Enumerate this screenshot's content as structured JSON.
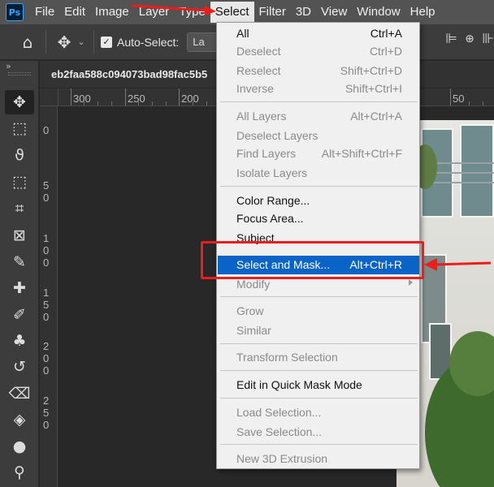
{
  "app": {
    "logo": "Ps"
  },
  "menubar": {
    "items": [
      "File",
      "Edit",
      "Image",
      "Layer",
      "Type",
      "Select",
      "Filter",
      "3D",
      "View",
      "Window",
      "Help"
    ],
    "active": "Select"
  },
  "options_bar": {
    "home_icon": "home-icon",
    "move_icon": "move-tool-icon",
    "auto_select_label": "Auto-Select:",
    "auto_select_checked": true,
    "layer_dropdown_value": "La"
  },
  "document": {
    "tab_title": "eb2faa588c094073bad98fac5b5"
  },
  "rulers": {
    "horizontal": [
      "300",
      "250",
      "200",
      "50"
    ],
    "vertical": [
      [
        "0"
      ],
      [
        "5",
        "0"
      ],
      [
        "1",
        "0",
        "0"
      ],
      [
        "1",
        "5",
        "0"
      ],
      [
        "2",
        "0",
        "0"
      ],
      [
        "2",
        "5",
        "0"
      ]
    ]
  },
  "toolbar": {
    "tools": [
      "move-tool-icon",
      "marquee-tool-icon",
      "lasso-tool-icon",
      "object-select-tool-icon",
      "crop-tool-icon",
      "frame-tool-icon",
      "eyedropper-tool-icon",
      "healing-brush-tool-icon",
      "brush-tool-icon",
      "clone-stamp-tool-icon",
      "history-brush-tool-icon",
      "eraser-tool-icon",
      "paint-bucket-tool-icon",
      "blur-tool-icon",
      "dodge-tool-icon"
    ]
  },
  "select_menu": {
    "items": [
      {
        "label": "All",
        "shortcut": "Ctrl+A",
        "enabled": true
      },
      {
        "label": "Deselect",
        "shortcut": "Ctrl+D",
        "enabled": false
      },
      {
        "label": "Reselect",
        "shortcut": "Shift+Ctrl+D",
        "enabled": false
      },
      {
        "label": "Inverse",
        "shortcut": "Shift+Ctrl+I",
        "enabled": false
      },
      {
        "label": "All Layers",
        "shortcut": "Alt+Ctrl+A",
        "enabled": false
      },
      {
        "label": "Deselect Layers",
        "shortcut": "",
        "enabled": false
      },
      {
        "label": "Find Layers",
        "shortcut": "Alt+Shift+Ctrl+F",
        "enabled": false
      },
      {
        "label": "Isolate Layers",
        "shortcut": "",
        "enabled": false
      },
      {
        "label": "Color Range...",
        "shortcut": "",
        "enabled": true
      },
      {
        "label": "Focus Area...",
        "shortcut": "",
        "enabled": true
      },
      {
        "label": "Subject",
        "shortcut": "",
        "enabled": true
      },
      {
        "label": "Select and Mask...",
        "shortcut": "Alt+Ctrl+R",
        "enabled": true,
        "highlighted": true
      },
      {
        "label": "Modify",
        "shortcut": "",
        "enabled": false,
        "submenu": true
      },
      {
        "label": "Grow",
        "shortcut": "",
        "enabled": false
      },
      {
        "label": "Similar",
        "shortcut": "",
        "enabled": false
      },
      {
        "label": "Transform Selection",
        "shortcut": "",
        "enabled": false
      },
      {
        "label": "Edit in Quick Mask Mode",
        "shortcut": "",
        "enabled": true
      },
      {
        "label": "Load Selection...",
        "shortcut": "",
        "enabled": false
      },
      {
        "label": "Save Selection...",
        "shortcut": "",
        "enabled": false
      },
      {
        "label": "New 3D Extrusion",
        "shortcut": "",
        "enabled": false
      }
    ]
  },
  "colors": {
    "annotation": "#ef1c1c",
    "highlight": "#0a64c8"
  }
}
